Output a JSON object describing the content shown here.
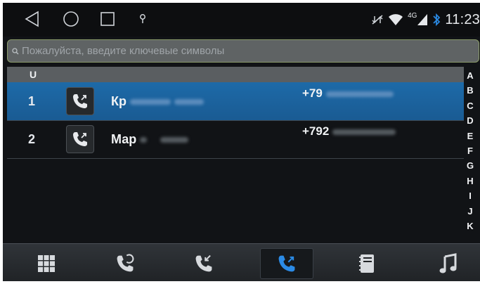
{
  "status": {
    "time": "11:23",
    "network": "4G"
  },
  "search": {
    "placeholder": "Пожалуйста, введите ключевые символы"
  },
  "section_header": "U",
  "contacts": [
    {
      "index": "1",
      "name": "Кр",
      "phone": "+79",
      "selected": true
    },
    {
      "index": "2",
      "name": "Мар",
      "phone": "+792",
      "selected": false
    }
  ],
  "alphabet": [
    "A",
    "B",
    "C",
    "D",
    "E",
    "F",
    "G",
    "H",
    "I",
    "J",
    "K"
  ],
  "bottom_tabs": [
    {
      "icon": "dialpad-icon"
    },
    {
      "icon": "call-history-icon"
    },
    {
      "icon": "missed-calls-icon"
    },
    {
      "icon": "outgoing-calls-icon",
      "active": true
    },
    {
      "icon": "phonebook-icon"
    },
    {
      "icon": "music-icon"
    }
  ],
  "colors": {
    "accent": "#1d6aa8",
    "background": "#111316"
  }
}
